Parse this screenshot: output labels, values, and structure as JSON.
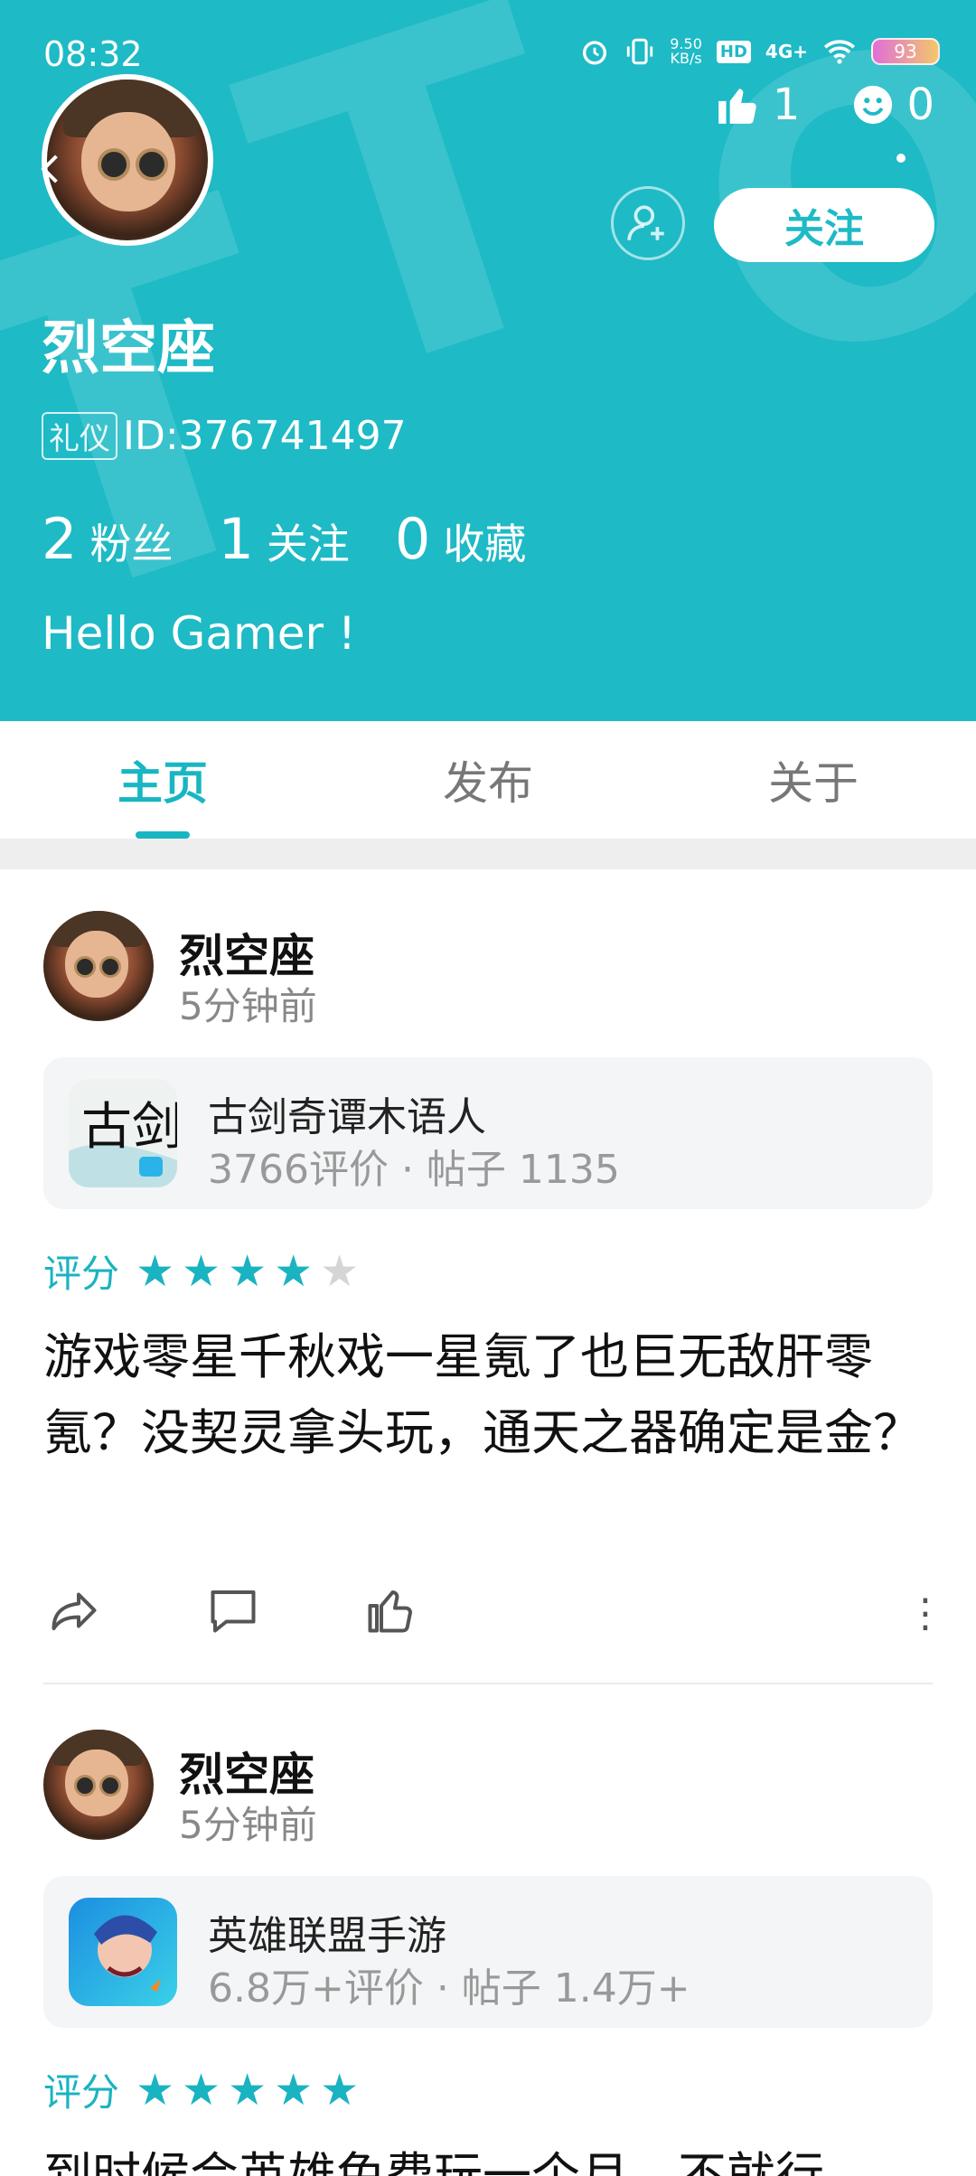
{
  "status_bar": {
    "time": "08:32",
    "net_speed": "9.50\nKB/s",
    "hd": "HD",
    "signal": "4G+",
    "battery": "93"
  },
  "header": {
    "likes": "1",
    "smiles": "0",
    "follow_label": "关注",
    "username": "烈空座",
    "badge": "礼仪",
    "user_id": "ID:376741497",
    "stats": [
      {
        "num": "2",
        "label": "粉丝"
      },
      {
        "num": "1",
        "label": "关注"
      },
      {
        "num": "0",
        "label": "收藏"
      }
    ],
    "bio": "Hello Gamer !"
  },
  "tabs": [
    {
      "label": "主页",
      "active": true
    },
    {
      "label": "发布",
      "active": false
    },
    {
      "label": "关于",
      "active": false
    }
  ],
  "posts": [
    {
      "author": "烈空座",
      "time": "5分钟前",
      "game": {
        "name": "古剑奇谭木语人",
        "meta": "3766评价 · 帖子 1135"
      },
      "rating_label": "评分",
      "stars": 4,
      "text": "游戏零星千秋戏一星氪了也巨无敌肝零氪？没契灵拿头玩，通天之器确定是金？"
    },
    {
      "author": "烈空座",
      "time": "5分钟前",
      "game": {
        "name": "英雄联盟手游",
        "meta": "6.8万+评价 · 帖子 1.4万+"
      },
      "rating_label": "评分",
      "stars": 5,
      "text": "到时候会英雄免费玩一个月，不就行"
    }
  ],
  "colors": {
    "accent": "#1ebac6",
    "star_off": "#d5d5d5"
  }
}
